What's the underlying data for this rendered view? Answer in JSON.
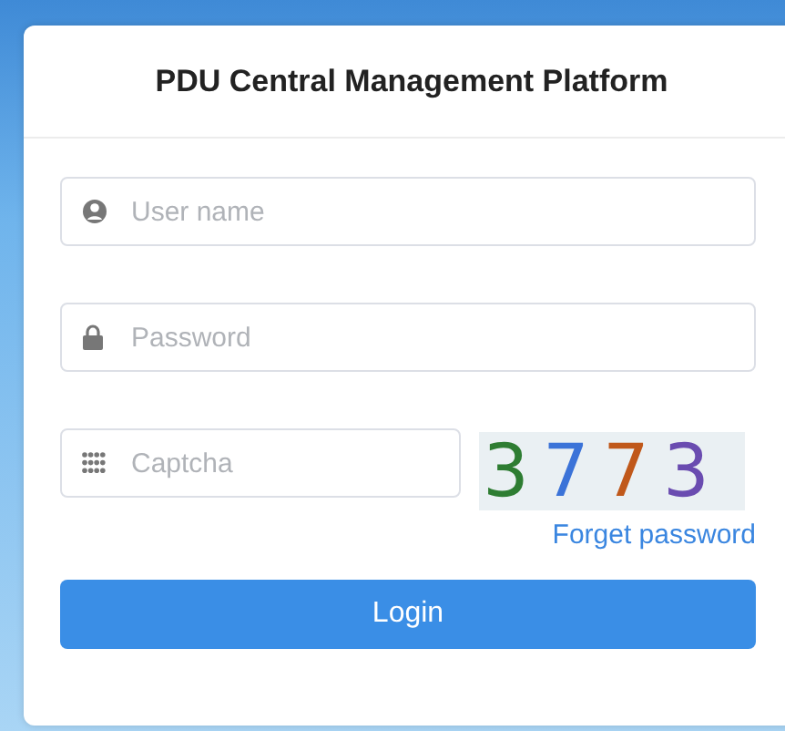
{
  "title": "PDU Central Management Platform",
  "fields": [
    {
      "kind": "user",
      "placeholder": "User name"
    },
    {
      "kind": "lock",
      "placeholder": "Password"
    }
  ],
  "captcha": {
    "placeholder": "Captcha",
    "code": "3773"
  },
  "forgot_link": "Forget password",
  "login_button": "Login"
}
